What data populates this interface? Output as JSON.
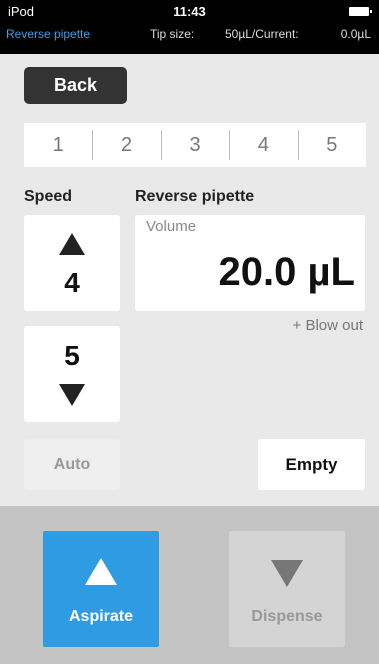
{
  "status_bar": {
    "carrier": "iPod",
    "time": "11:43",
    "mode": "Reverse pipette",
    "tip_size_label": "Tip size:",
    "tip_size_value": "50µL/Current:",
    "current_value": "0.0µL"
  },
  "nav": {
    "back_label": "Back"
  },
  "programs": [
    "1",
    "2",
    "3",
    "4",
    "5"
  ],
  "speed": {
    "label": "Speed",
    "aspirate": "4",
    "dispense": "5"
  },
  "pipette": {
    "mode_title": "Reverse pipette",
    "volume_label": "Volume",
    "volume_value": "20.0 µL",
    "blow_out": "+ Blow out"
  },
  "actions": {
    "auto_label": "Auto",
    "empty_label": "Empty",
    "aspirate_label": "Aspirate",
    "dispense_label": "Dispense"
  },
  "colors": {
    "accent": "#2e9be3",
    "status_bar_bg": "#000000",
    "mode_text": "#3aa0e6"
  }
}
